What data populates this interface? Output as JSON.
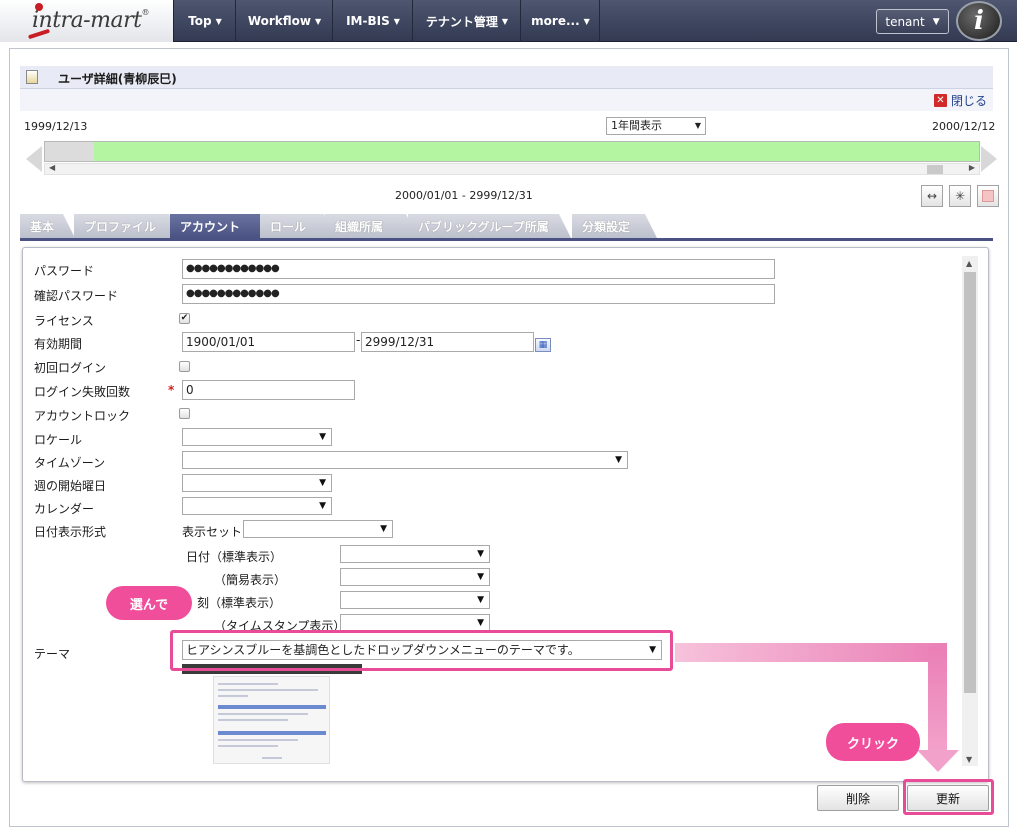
{
  "nav": {
    "logo_text": "intra-mart",
    "items": [
      {
        "label": "Top"
      },
      {
        "label": "Workflow"
      },
      {
        "label": "IM-BIS"
      },
      {
        "label": "テナント管理"
      },
      {
        "label": "more..."
      }
    ],
    "tenant_label": "tenant",
    "user_badge": "i"
  },
  "page": {
    "title": "ユーザ詳細(青柳辰巳)",
    "close_label": "閉じる"
  },
  "timeline": {
    "start_date": "1999/12/13",
    "end_date": "2000/12/12",
    "view_select": "1年間表示",
    "range_text": "2000/01/01 - 2999/12/31"
  },
  "tabs": [
    {
      "label": "基本"
    },
    {
      "label": "プロファイル"
    },
    {
      "label": "アカウント"
    },
    {
      "label": "ロール"
    },
    {
      "label": "組織所属"
    },
    {
      "label": "パブリックグループ所属"
    },
    {
      "label": "分類設定"
    }
  ],
  "form": {
    "password": {
      "label": "パスワード",
      "value": "●●●●●●●●●●●●"
    },
    "password_confirm": {
      "label": "確認パスワード",
      "value": "●●●●●●●●●●●●"
    },
    "license": {
      "label": "ライセンス",
      "checked": true
    },
    "validity": {
      "label": "有効期間",
      "from": "1900/01/01",
      "separator": "-",
      "to": "2999/12/31"
    },
    "first_login": {
      "label": "初回ログイン"
    },
    "login_failures": {
      "label": "ログイン失敗回数",
      "required_mark": "*",
      "value": "0"
    },
    "account_lock": {
      "label": "アカウントロック"
    },
    "locale": {
      "label": "ロケール"
    },
    "timezone": {
      "label": "タイムゾーン"
    },
    "week_start": {
      "label": "週の開始曜日"
    },
    "calendar": {
      "label": "カレンダー"
    },
    "date_format": {
      "label": "日付表示形式",
      "display_set_label": "表示セット",
      "date_standard_label": "日付（標準表示）",
      "date_simple_label": "（簡易表示）",
      "time_standard_label": "刻（標準表示）",
      "timestamp_label": "（タイムスタンプ表示）"
    },
    "theme": {
      "label": "テーマ",
      "value": "ヒアシンスブルーを基調色としたドロップダウンメニューのテーマです。"
    }
  },
  "buttons": {
    "delete": "削除",
    "update": "更新"
  },
  "annotations": {
    "select_hint": "選んで",
    "click_hint": "クリック"
  },
  "colors": {
    "accent_pink": "#f04d9b",
    "tab_active": "#4a5283",
    "timeline_fill": "#b3f5a1"
  }
}
